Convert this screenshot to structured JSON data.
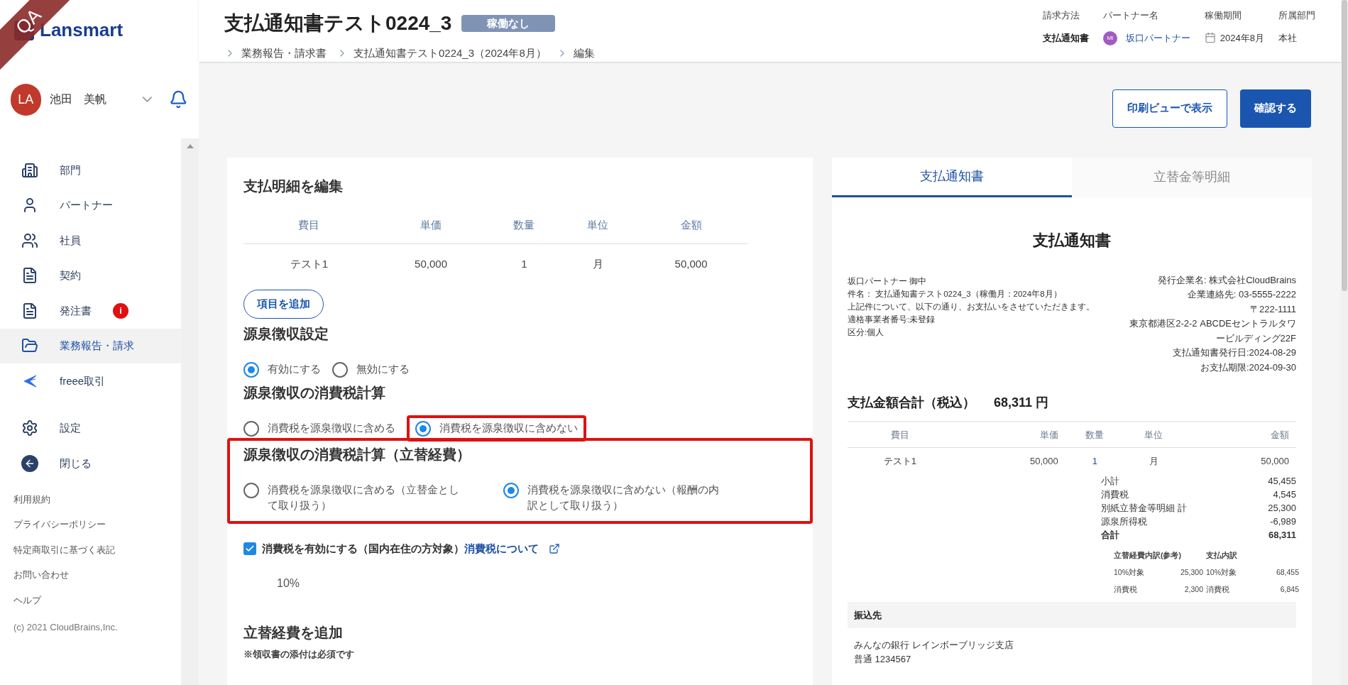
{
  "env_badge": "QA",
  "logo": "Lansmart",
  "user": {
    "initials": "LA",
    "name": "池田　美帆"
  },
  "nav": [
    {
      "label": "部門",
      "selected": false
    },
    {
      "label": "パートナー",
      "selected": false
    },
    {
      "label": "社員",
      "selected": false
    },
    {
      "label": "契約",
      "selected": false
    },
    {
      "label": "発注書",
      "selected": false,
      "alert": "i"
    },
    {
      "label": "業務報告・請求",
      "selected": true
    },
    {
      "label": "freee取引",
      "selected": false
    }
  ],
  "nav_bottom": [
    {
      "label": "設定"
    },
    {
      "label": "閉じる"
    }
  ],
  "footer_links": [
    "利用規約",
    "プライバシーポリシー",
    "特定商取引に基づく表記",
    "お問い合わせ",
    "ヘルプ"
  ],
  "copyright": "(c) 2021 CloudBrains,Inc.",
  "header": {
    "title": "支払通知書テスト0224_3",
    "status": "稼働なし",
    "breadcrumbs": [
      "業務報告・請求書",
      "支払通知書テスト0224_3（2024年8月）",
      "編集"
    ],
    "meta": [
      {
        "label": "請求方法",
        "value": "支払通知書",
        "kind": "bold"
      },
      {
        "label": "パートナー名",
        "value": "坂口パートナー",
        "kind": "partner",
        "avatar": "MI"
      },
      {
        "label": "稼働期間",
        "value": "2024年8月",
        "kind": "date"
      },
      {
        "label": "所属部門",
        "value": "本社",
        "kind": "plain"
      }
    ]
  },
  "actions": [
    {
      "label": "印刷ビューで表示",
      "kind": "outline"
    },
    {
      "label": "確認する",
      "kind": "primary"
    }
  ],
  "edit": {
    "title": "支払明細を編集",
    "columns": [
      "費目",
      "単価",
      "数量",
      "単位",
      "金額"
    ],
    "rows": [
      [
        "テスト1",
        "50,000",
        "1",
        "月",
        "50,000"
      ]
    ],
    "add_button": "項目を追加",
    "sections": [
      {
        "title": "源泉徴収設定",
        "highlighted": false,
        "options": [
          {
            "label": "有効にする",
            "selected": true,
            "highlighted": false
          },
          {
            "label": "無効にする",
            "selected": false,
            "highlighted": false
          }
        ]
      },
      {
        "title": "源泉徴収の消費税計算",
        "highlighted": false,
        "options": [
          {
            "label": "消費税を源泉徴収に含める",
            "selected": false,
            "highlighted": false
          },
          {
            "label": "消費税を源泉徴収に含めない",
            "selected": true,
            "highlighted": true
          }
        ]
      },
      {
        "title": "源泉徴収の消費税計算（立替経費）",
        "highlighted": true,
        "options": [
          {
            "label": "消費税を源泉徴収に含める（立替金として取り扱う）",
            "selected": false,
            "highlighted": false
          },
          {
            "label": "消費税を源泉徴収に含めない（報酬の内訳として取り扱う）",
            "selected": true,
            "highlighted": false
          }
        ]
      }
    ],
    "tax_checkbox": {
      "label": "消費税を有効にする（国内在住の方対象）",
      "checked": true,
      "link": "消費税について"
    },
    "tax_rate": "10%",
    "expense_title": "立替経費を追加",
    "expense_note": "※領収書の添付は必須です"
  },
  "preview": {
    "tabs": [
      {
        "label": "支払通知書",
        "selected": true
      },
      {
        "label": "立替金等明細",
        "selected": false
      }
    ],
    "title": "支払通知書",
    "left_lines": [
      "坂口パートナー 御中",
      "件名： 支払通知書テスト0224_3（稼働月：2024年8月）",
      "上記件について、以下の通り、お支払いをさせていただきます。",
      "適格事業者番号:未登録",
      "区分:個人"
    ],
    "right_lines": [
      "発行企業名: 株式会社CloudBrains",
      "企業連絡先: 03-5555-2222",
      "〒222-1111",
      "東京都港区2-2-2 ABCDEセントラルタワ",
      "ービルディング22F",
      "支払通知書発行日:2024-08-29",
      "お支払期限:2024-09-30"
    ],
    "total_label": "支払金額合計（税込）",
    "total_value": "68,311 円",
    "columns": [
      "費目",
      "単価",
      "数量",
      "単位",
      "金額"
    ],
    "rows": [
      [
        "テスト1",
        "50,000",
        "1",
        "月",
        "50,000"
      ]
    ],
    "summary": [
      {
        "label": "小計",
        "value": "45,455",
        "bold": false
      },
      {
        "label": "消費税",
        "value": "4,545",
        "bold": false
      },
      {
        "label": "別紙立替金等明細 計",
        "value": "25,300",
        "bold": false
      },
      {
        "label": "源泉所得税",
        "value": "-6,989",
        "bold": false
      },
      {
        "label": "合計",
        "value": "68,311",
        "bold": true
      }
    ],
    "breakdown": {
      "headers": [
        "立替経費内訳(参考)",
        "支払内訳"
      ],
      "rows": [
        [
          "10%対象",
          "25,300",
          "10%対象",
          "68,455"
        ],
        [
          "消費税",
          "2,300",
          "消費税",
          "6,845"
        ]
      ]
    },
    "bank_title": "振込先",
    "bank_lines": [
      "みんなの銀行 レインボーブリッジ支店",
      "普通 1234567"
    ]
  }
}
